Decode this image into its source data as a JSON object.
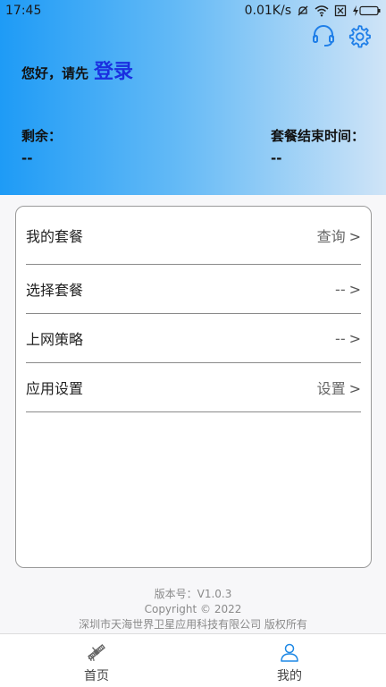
{
  "status_bar": {
    "time": "17:45",
    "speed": "0.01K/s"
  },
  "header": {
    "greeting": "您好，请先",
    "login_link": "登录",
    "remaining_label": "剩余：",
    "remaining_value": "--",
    "plan_end_label": "套餐结束时间：",
    "plan_end_value": "--",
    "icons": [
      "headset-icon",
      "gear-icon"
    ]
  },
  "menu": {
    "items": [
      {
        "label": "我的套餐",
        "value": "查询"
      },
      {
        "label": "选择套餐",
        "value": "--"
      },
      {
        "label": "上网策略",
        "value": "--"
      },
      {
        "label": "应用设置",
        "value": "设置"
      }
    ],
    "chevron": ">"
  },
  "footer": {
    "version": "版本号：V1.0.3",
    "copyright": "Copyright © 2022",
    "company": "深圳市天海世界卫星应用科技有限公司 版权所有"
  },
  "tabbar": {
    "tabs": [
      {
        "label": "首页",
        "icon": "satellite-icon"
      },
      {
        "label": "我的",
        "icon": "user-icon"
      }
    ]
  },
  "colors": {
    "accent": "#1e9bf6",
    "login": "#1a2fe0",
    "active_tab": "#1e88e5"
  }
}
